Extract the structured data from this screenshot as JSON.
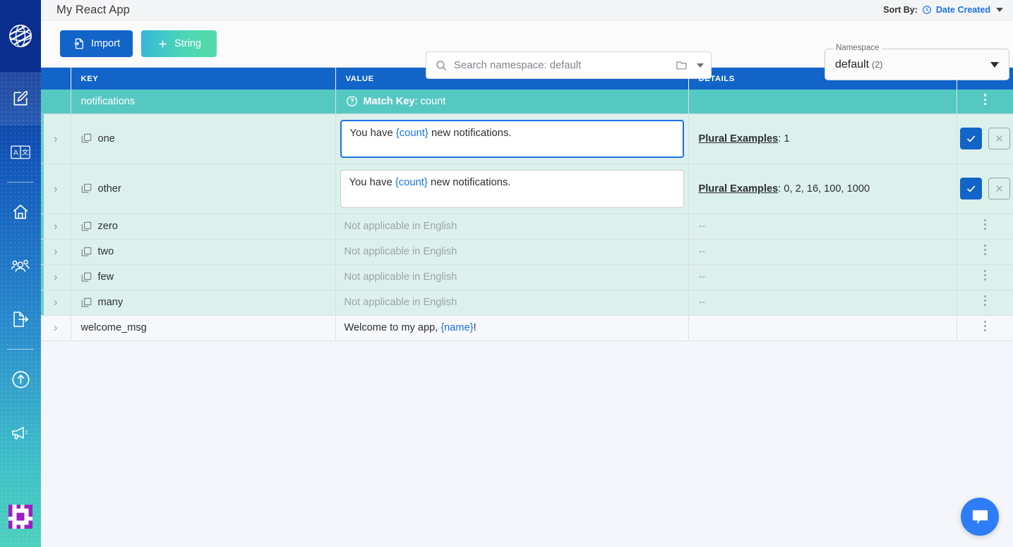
{
  "app": {
    "title": "My React App"
  },
  "sortby": {
    "label": "Sort By:",
    "value": "Date Created"
  },
  "toolbar": {
    "import_label": "Import",
    "string_label": "String"
  },
  "search": {
    "placeholder": "Search namespace: default",
    "value": ""
  },
  "namespace": {
    "legend": "Namespace",
    "value": "default",
    "count": "(2)"
  },
  "table": {
    "columns": [
      "KEY",
      "VALUE",
      "DETAILS"
    ],
    "rows": [
      {
        "type": "group",
        "key": "notifications",
        "value_label": "Match Key",
        "value_detail": ": count",
        "details": "",
        "action": "kebab"
      },
      {
        "type": "child",
        "key": "one",
        "editor": true,
        "focused": true,
        "value_pre": "You have ",
        "value_ph": "{count}",
        "value_post": " new notifications.",
        "details_label": "Plural Examples",
        "details_value": ": 1",
        "action": "confirm"
      },
      {
        "type": "child",
        "key": "other",
        "editor": true,
        "focused": false,
        "value_pre": "You have ",
        "value_ph": "{count}",
        "value_post": " new notifications.",
        "details_label": "Plural Examples",
        "details_value": ": 0, 2, 16, 100, 1000",
        "action": "confirm"
      },
      {
        "type": "child",
        "key": "zero",
        "editor": false,
        "value_na": "Not applicable in English",
        "details_dash": "--",
        "action": "kebab"
      },
      {
        "type": "child",
        "key": "two",
        "editor": false,
        "value_na": "Not applicable in English",
        "details_dash": "--",
        "action": "kebab"
      },
      {
        "type": "child",
        "key": "few",
        "editor": false,
        "value_na": "Not applicable in English",
        "details_dash": "--",
        "action": "kebab"
      },
      {
        "type": "child",
        "key": "many",
        "editor": false,
        "value_na": "Not applicable in English",
        "details_dash": "--",
        "action": "kebab"
      },
      {
        "type": "plain",
        "key": "welcome_msg",
        "editor": false,
        "value_pre": "Welcome to my app, ",
        "value_ph": "{name}",
        "value_post": "!",
        "details": "",
        "action": "kebab"
      }
    ]
  },
  "sidebar": {
    "items": [
      {
        "name": "edit-icon",
        "active": true
      },
      {
        "name": "translate-icon",
        "active": false
      },
      {
        "divider": true
      },
      {
        "name": "home-icon",
        "active": false
      },
      {
        "name": "people-icon",
        "active": false
      },
      {
        "name": "document-export-icon",
        "active": false
      },
      {
        "divider": true
      },
      {
        "name": "upload-circle-icon",
        "active": false
      },
      {
        "name": "megaphone-icon",
        "active": false
      }
    ]
  },
  "colors": {
    "brand_blue": "#1264c9",
    "accent_teal": "#56c8c2",
    "link_blue": "#1a73e8",
    "row_child_bg": "#dcf1ec",
    "page_bg": "#f4f6fb"
  }
}
